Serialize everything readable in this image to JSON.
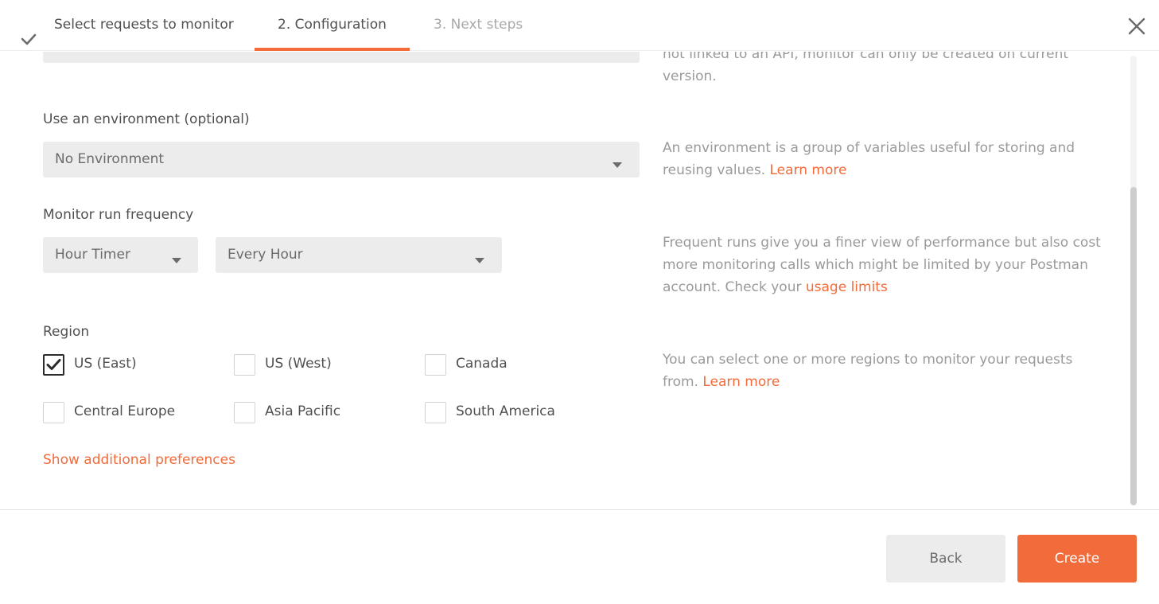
{
  "stepper": {
    "steps": [
      {
        "label": "Select requests to monitor",
        "state": "done"
      },
      {
        "label": "2. Configuration",
        "state": "active"
      },
      {
        "label": "3. Next steps",
        "state": "upcoming"
      }
    ]
  },
  "help": {
    "version": {
      "text": "not linked to an API, monitor can only be created on current version."
    },
    "environment": {
      "text": "An environment is a group of variables useful for storing and reusing values. ",
      "link": "Learn more"
    },
    "frequency": {
      "text": "Frequent runs give you a finer view of performance but also cost more monitoring calls which might be limited by your Postman account. Check your ",
      "link": "usage limits"
    },
    "region": {
      "text": "You can select one or more regions to monitor your requests from. ",
      "link": "Learn more"
    }
  },
  "environment": {
    "label": "Use an environment (optional)",
    "value": "No Environment"
  },
  "frequency": {
    "label": "Monitor run frequency",
    "timer_value": "Hour Timer",
    "interval_value": "Every Hour"
  },
  "region": {
    "label": "Region",
    "options": [
      {
        "label": "US (East)",
        "checked": true
      },
      {
        "label": "US (West)",
        "checked": false
      },
      {
        "label": "Canada",
        "checked": false
      },
      {
        "label": "Central Europe",
        "checked": false
      },
      {
        "label": "Asia Pacific",
        "checked": false
      },
      {
        "label": "South America",
        "checked": false
      }
    ]
  },
  "show_additional_preferences": "Show additional preferences",
  "footer": {
    "back_label": "Back",
    "create_label": "Create"
  },
  "colors": {
    "accent": "#f26b3a",
    "field_bg": "#ececec"
  },
  "icons": {
    "step_done": "check-icon",
    "close": "close-icon",
    "dropdown": "caret-down-icon",
    "checkbox_checked": "checkmark-icon"
  }
}
